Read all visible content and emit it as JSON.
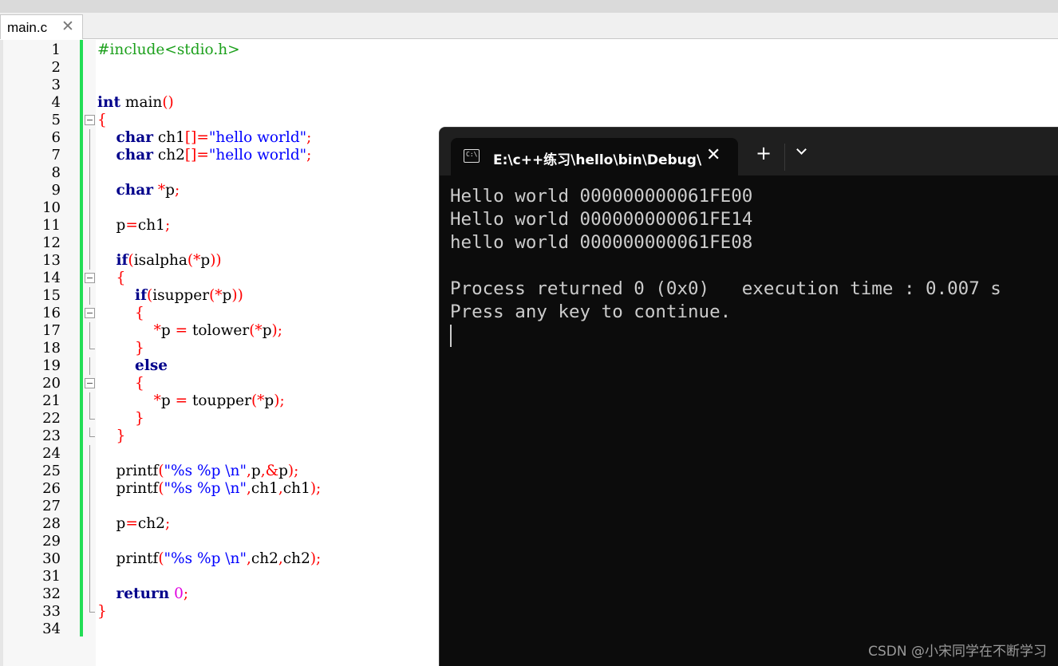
{
  "editor": {
    "tab": {
      "label": "main.c",
      "close": "✕"
    },
    "line_numbers": [
      "1",
      "2",
      "3",
      "4",
      "5",
      "6",
      "7",
      "8",
      "9",
      "10",
      "11",
      "12",
      "13",
      "14",
      "15",
      "16",
      "17",
      "18",
      "19",
      "20",
      "21",
      "22",
      "23",
      "24",
      "25",
      "26",
      "27",
      "28",
      "29",
      "30",
      "31",
      "32",
      "33",
      "34"
    ],
    "fold_markers": [
      "",
      "",
      "",
      "",
      "box",
      "line",
      "line",
      "line",
      "line",
      "line",
      "line",
      "line",
      "line",
      "box",
      "line",
      "box",
      "line",
      "end",
      "line",
      "box",
      "line",
      "end",
      "end",
      "line",
      "line",
      "line",
      "line",
      "line",
      "line",
      "line",
      "line",
      "line",
      "end",
      ""
    ],
    "code_lines": [
      [
        {
          "t": "#include<stdio.h>",
          "c": "pp"
        }
      ],
      [],
      [],
      [
        {
          "t": "int",
          "c": "kw"
        },
        {
          "t": " main",
          "c": "id"
        },
        {
          "t": "()",
          "c": "op"
        }
      ],
      [
        {
          "t": "{",
          "c": "op"
        }
      ],
      [
        {
          "t": "    ",
          "c": "id"
        },
        {
          "t": "char",
          "c": "kw"
        },
        {
          "t": " ch1",
          "c": "id"
        },
        {
          "t": "[]=",
          "c": "op"
        },
        {
          "t": "\"hello world\"",
          "c": "str"
        },
        {
          "t": ";",
          "c": "op"
        }
      ],
      [
        {
          "t": "    ",
          "c": "id"
        },
        {
          "t": "char",
          "c": "kw"
        },
        {
          "t": " ch2",
          "c": "id"
        },
        {
          "t": "[]=",
          "c": "op"
        },
        {
          "t": "\"hello world\"",
          "c": "str"
        },
        {
          "t": ";",
          "c": "op"
        }
      ],
      [],
      [
        {
          "t": "    ",
          "c": "id"
        },
        {
          "t": "char",
          "c": "kw"
        },
        {
          "t": " *",
          "c": "op"
        },
        {
          "t": "p",
          "c": "id"
        },
        {
          "t": ";",
          "c": "op"
        }
      ],
      [],
      [
        {
          "t": "    p",
          "c": "id"
        },
        {
          "t": "=",
          "c": "op"
        },
        {
          "t": "ch1",
          "c": "id"
        },
        {
          "t": ";",
          "c": "op"
        }
      ],
      [],
      [
        {
          "t": "    ",
          "c": "id"
        },
        {
          "t": "if",
          "c": "kw"
        },
        {
          "t": "(",
          "c": "op"
        },
        {
          "t": "isalpha",
          "c": "id"
        },
        {
          "t": "(*",
          "c": "op"
        },
        {
          "t": "p",
          "c": "id"
        },
        {
          "t": "))",
          "c": "op"
        }
      ],
      [
        {
          "t": "    ",
          "c": "id"
        },
        {
          "t": "{",
          "c": "op"
        }
      ],
      [
        {
          "t": "        ",
          "c": "id"
        },
        {
          "t": "if",
          "c": "kw"
        },
        {
          "t": "(",
          "c": "op"
        },
        {
          "t": "isupper",
          "c": "id"
        },
        {
          "t": "(*",
          "c": "op"
        },
        {
          "t": "p",
          "c": "id"
        },
        {
          "t": "))",
          "c": "op"
        }
      ],
      [
        {
          "t": "        ",
          "c": "id"
        },
        {
          "t": "{",
          "c": "op"
        }
      ],
      [
        {
          "t": "            ",
          "c": "id"
        },
        {
          "t": "*",
          "c": "op"
        },
        {
          "t": "p ",
          "c": "id"
        },
        {
          "t": "=",
          "c": "op"
        },
        {
          "t": " tolower",
          "c": "id"
        },
        {
          "t": "(*",
          "c": "op"
        },
        {
          "t": "p",
          "c": "id"
        },
        {
          "t": ");",
          "c": "op"
        }
      ],
      [
        {
          "t": "        ",
          "c": "id"
        },
        {
          "t": "}",
          "c": "op"
        }
      ],
      [
        {
          "t": "        ",
          "c": "id"
        },
        {
          "t": "else",
          "c": "kw"
        }
      ],
      [
        {
          "t": "        ",
          "c": "id"
        },
        {
          "t": "{",
          "c": "op"
        }
      ],
      [
        {
          "t": "            ",
          "c": "id"
        },
        {
          "t": "*",
          "c": "op"
        },
        {
          "t": "p ",
          "c": "id"
        },
        {
          "t": "=",
          "c": "op"
        },
        {
          "t": " toupper",
          "c": "id"
        },
        {
          "t": "(*",
          "c": "op"
        },
        {
          "t": "p",
          "c": "id"
        },
        {
          "t": ");",
          "c": "op"
        }
      ],
      [
        {
          "t": "        ",
          "c": "id"
        },
        {
          "t": "}",
          "c": "op"
        }
      ],
      [
        {
          "t": "    ",
          "c": "id"
        },
        {
          "t": "}",
          "c": "op"
        }
      ],
      [],
      [
        {
          "t": "    printf",
          "c": "id"
        },
        {
          "t": "(",
          "c": "op"
        },
        {
          "t": "\"%s %p \\n\"",
          "c": "str"
        },
        {
          "t": ",",
          "c": "op"
        },
        {
          "t": "p",
          "c": "id"
        },
        {
          "t": ",&",
          "c": "op"
        },
        {
          "t": "p",
          "c": "id"
        },
        {
          "t": ");",
          "c": "op"
        }
      ],
      [
        {
          "t": "    printf",
          "c": "id"
        },
        {
          "t": "(",
          "c": "op"
        },
        {
          "t": "\"%s %p \\n\"",
          "c": "str"
        },
        {
          "t": ",",
          "c": "op"
        },
        {
          "t": "ch1",
          "c": "id"
        },
        {
          "t": ",",
          "c": "op"
        },
        {
          "t": "ch1",
          "c": "id"
        },
        {
          "t": ");",
          "c": "op"
        }
      ],
      [],
      [
        {
          "t": "    p",
          "c": "id"
        },
        {
          "t": "=",
          "c": "op"
        },
        {
          "t": "ch2",
          "c": "id"
        },
        {
          "t": ";",
          "c": "op"
        }
      ],
      [],
      [
        {
          "t": "    printf",
          "c": "id"
        },
        {
          "t": "(",
          "c": "op"
        },
        {
          "t": "\"%s %p \\n\"",
          "c": "str"
        },
        {
          "t": ",",
          "c": "op"
        },
        {
          "t": "ch2",
          "c": "id"
        },
        {
          "t": ",",
          "c": "op"
        },
        {
          "t": "ch2",
          "c": "id"
        },
        {
          "t": ");",
          "c": "op"
        }
      ],
      [],
      [
        {
          "t": "    ",
          "c": "id"
        },
        {
          "t": "return",
          "c": "kw"
        },
        {
          "t": " ",
          "c": "id"
        },
        {
          "t": "0",
          "c": "num"
        },
        {
          "t": ";",
          "c": "op"
        }
      ],
      [
        {
          "t": "}",
          "c": "op"
        }
      ],
      []
    ]
  },
  "terminal": {
    "tab_title": "E:\\c++练习\\hello\\bin\\Debug\\",
    "icon": "terminal-icon",
    "tab_close": "✕",
    "new_tab": "+",
    "output_lines": [
      "Hello world 000000000061FE00",
      "Hello world 000000000061FE14",
      "hello world 000000000061FE08",
      "",
      "Process returned 0 (0x0)   execution time : 0.007 s",
      "Press any key to continue."
    ]
  },
  "watermark": "CSDN @小宋同学在不断学习"
}
